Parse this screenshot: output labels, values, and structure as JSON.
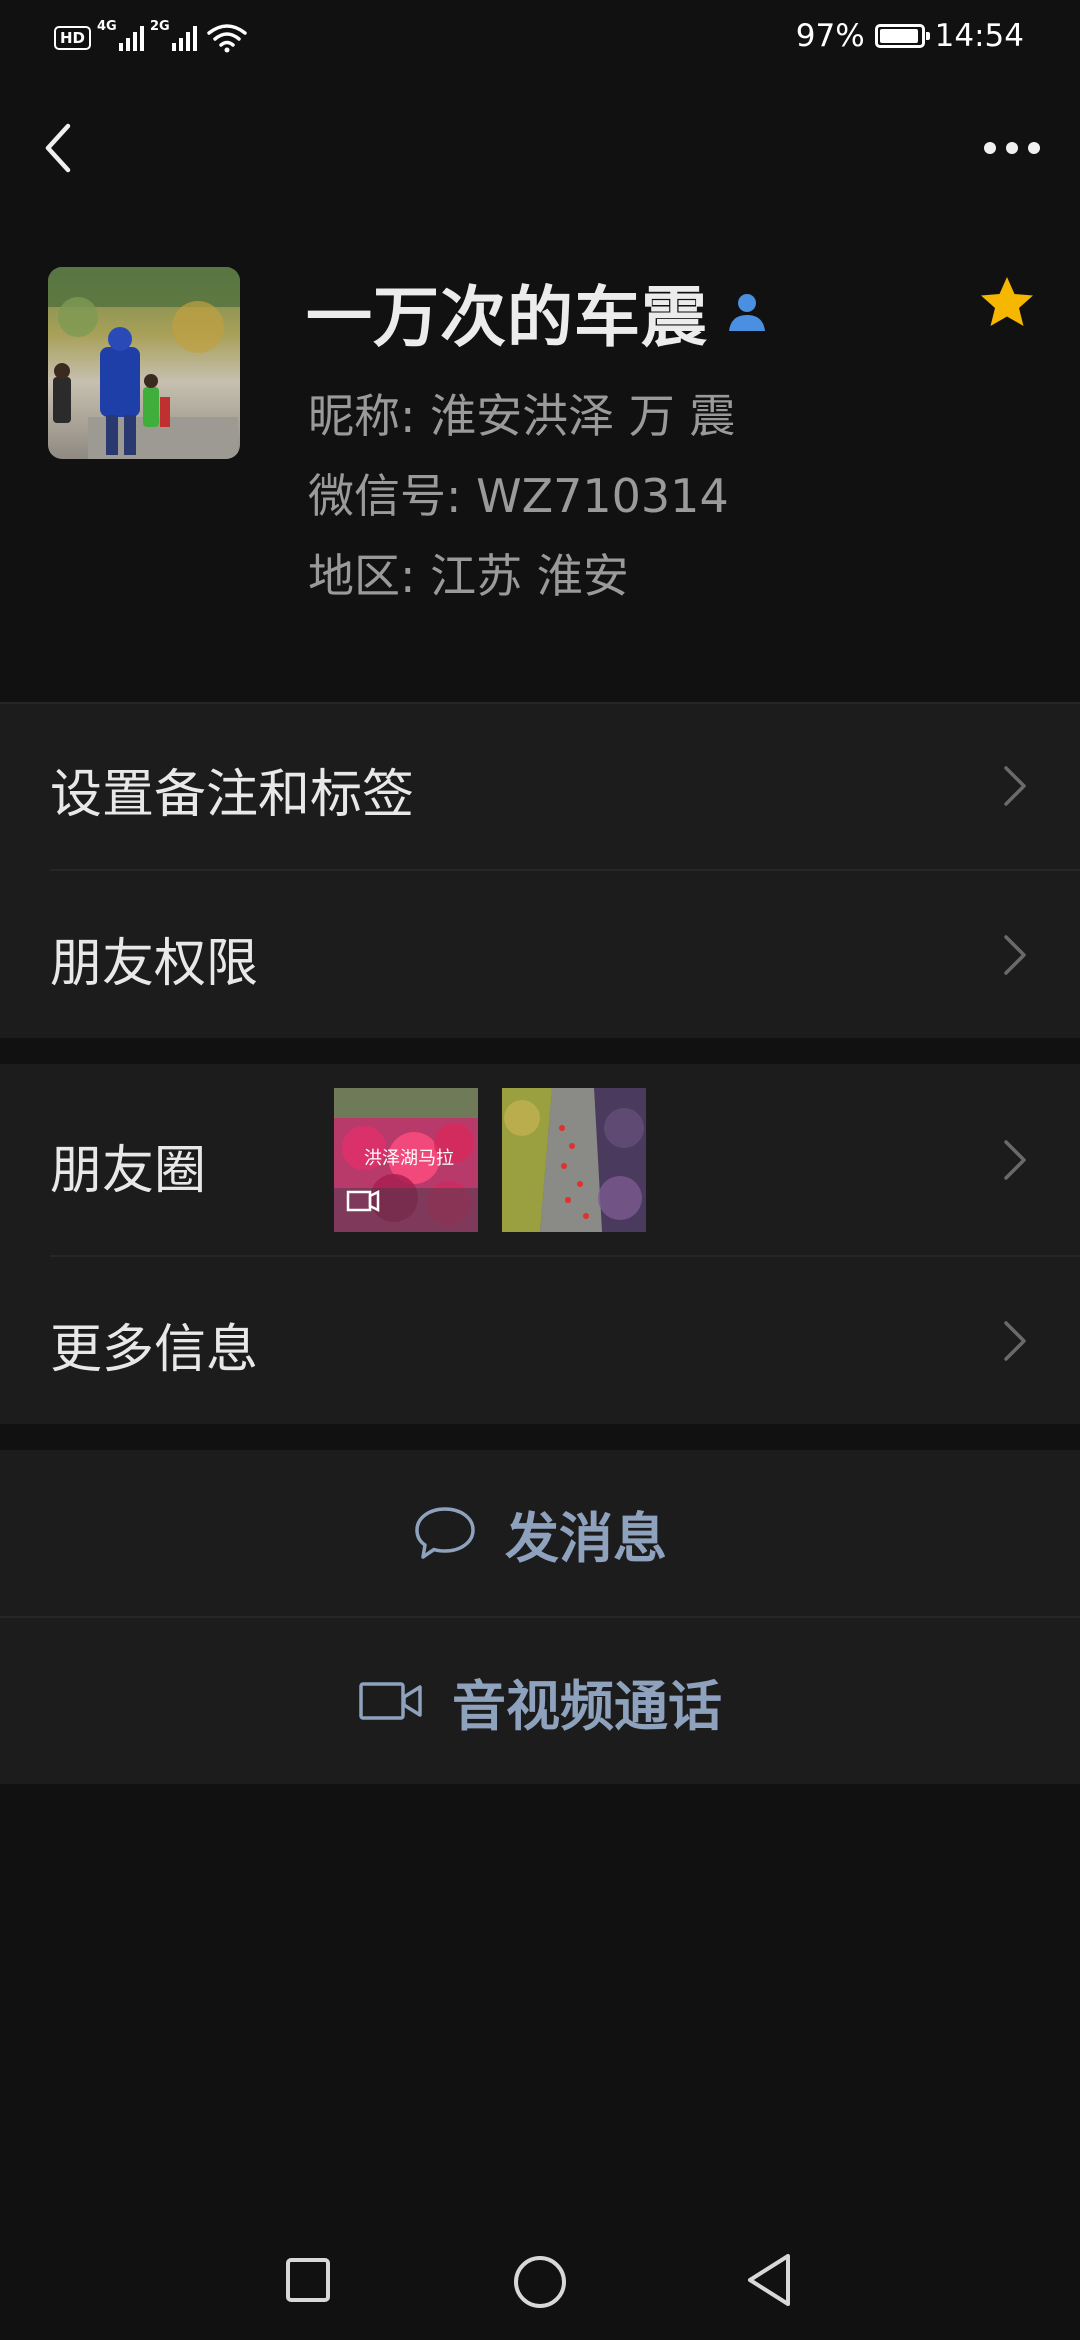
{
  "status_bar": {
    "hd_label": "HD",
    "net_4g": "4G",
    "net_2g": "2G",
    "battery_percent": "97%",
    "battery_level": 0.97,
    "time": "14:54"
  },
  "profile": {
    "display_name": "一万次的车震",
    "nickname_line": "昵称:  淮安洪泽  万  震",
    "wechat_id_line": "微信号:  WZ710314",
    "region_line": "地区:  江苏  淮安",
    "starred": true,
    "star_color": "#f5b700",
    "badge_color": "#4a8fe0"
  },
  "settings": {
    "remark_label": "设置备注和标签",
    "permissions_label": "朋友权限"
  },
  "moments": {
    "label": "朋友圈",
    "thumb1_caption": "洪泽湖马拉",
    "thumb1_has_video": true
  },
  "more_info_label": "更多信息",
  "actions": {
    "message_label": "发消息",
    "call_label": "音视频通话",
    "accent_color": "#8fa2bd"
  },
  "icons": {
    "back": "chevron-left",
    "more": "ellipsis",
    "contact_badge": "person-icon",
    "star": "star-icon",
    "message": "speech-bubble-icon",
    "call": "video-camera-icon",
    "sys_recents": "square",
    "sys_home": "circle",
    "sys_back": "triangle"
  }
}
